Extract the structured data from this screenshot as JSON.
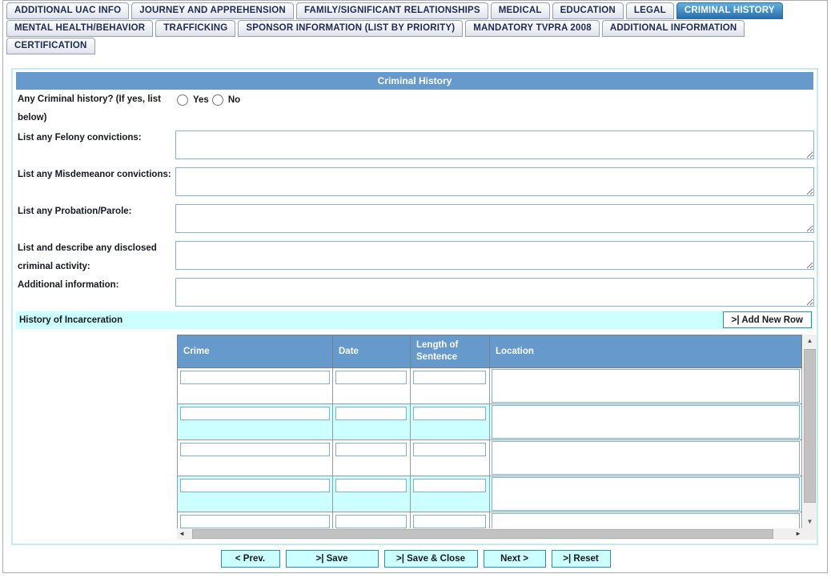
{
  "tabs": {
    "rows": [
      [
        {
          "label": "ADDITIONAL UAC INFO",
          "active": false
        },
        {
          "label": "JOURNEY AND APPREHENSION",
          "active": false
        },
        {
          "label": "FAMILY/SIGNIFICANT RELATIONSHIPS",
          "active": false
        },
        {
          "label": "MEDICAL",
          "active": false
        },
        {
          "label": "EDUCATION",
          "active": false
        },
        {
          "label": "LEGAL",
          "active": false
        },
        {
          "label": "CRIMINAL HISTORY",
          "active": true
        }
      ],
      [
        {
          "label": "MENTAL HEALTH/BEHAVIOR",
          "active": false
        },
        {
          "label": "TRAFFICKING",
          "active": false
        },
        {
          "label": "SPONSOR INFORMATION (LIST BY PRIORITY)",
          "active": false
        },
        {
          "label": "MANDATORY TVPRA 2008",
          "active": false
        },
        {
          "label": "ADDITIONAL INFORMATION",
          "active": false
        }
      ],
      [
        {
          "label": "CERTIFICATION",
          "active": false
        }
      ]
    ]
  },
  "panel": {
    "title": "Criminal History"
  },
  "form": {
    "question": {
      "label": "Any Criminal history? (If yes, list below)",
      "options": [
        {
          "label": "Yes",
          "checked": false
        },
        {
          "label": "No",
          "checked": false
        }
      ]
    },
    "fields": [
      {
        "label": "List any Felony convictions:",
        "value": ""
      },
      {
        "label": "List any Misdemeanor convictions:",
        "value": ""
      },
      {
        "label": "List any Probation/Parole:",
        "value": ""
      },
      {
        "label": "List and describe any disclosed criminal activity:",
        "value": ""
      },
      {
        "label": "Additional information:",
        "value": ""
      }
    ]
  },
  "incarceration": {
    "section_label": "History of Incarceration",
    "add_row_label": ">| Add New Row",
    "columns": [
      "Crime",
      "Date",
      "Length of Sentence",
      "Location"
    ],
    "rows": [
      {
        "crime": "",
        "date": "",
        "length_of_sentence": "",
        "location": ""
      },
      {
        "crime": "",
        "date": "",
        "length_of_sentence": "",
        "location": ""
      },
      {
        "crime": "",
        "date": "",
        "length_of_sentence": "",
        "location": ""
      },
      {
        "crime": "",
        "date": "",
        "length_of_sentence": "",
        "location": ""
      },
      {
        "crime": "",
        "date": "",
        "length_of_sentence": "",
        "location": ""
      }
    ]
  },
  "footer_buttons": [
    {
      "label": "< Prev."
    },
    {
      "label": ">| Save"
    },
    {
      "label": ">| Save & Close"
    },
    {
      "label": "Next >"
    },
    {
      "label": ">| Reset"
    }
  ],
  "icons": {
    "scroll_up": "▲",
    "scroll_down": "▼",
    "scroll_left": "◄",
    "scroll_right": "►"
  },
  "colors": {
    "header_blue": "#6699cc",
    "section_cyan": "#ccffff",
    "active_tab_blue": "#2a6dab",
    "input_border_blue": "#85aed6",
    "tab_text_navy": "#1c2b55"
  }
}
